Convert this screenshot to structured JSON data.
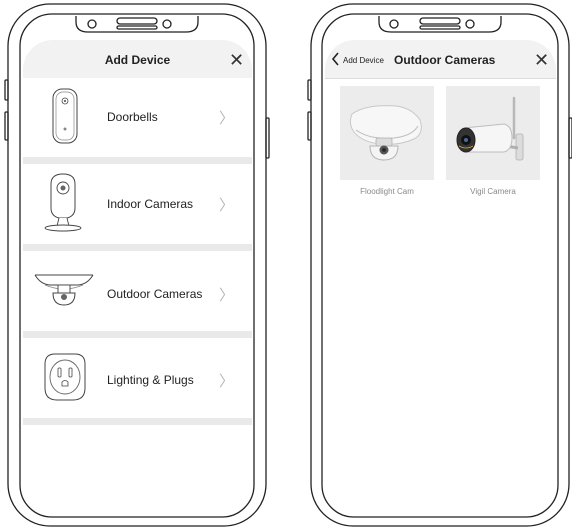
{
  "left_screen": {
    "header_title": "Add Device",
    "close_icon": "close-icon",
    "items": [
      {
        "label": "Doorbells",
        "icon": "doorbell-icon"
      },
      {
        "label": "Indoor Cameras",
        "icon": "indoor-camera-icon"
      },
      {
        "label": "Outdoor Cameras",
        "icon": "outdoor-camera-icon"
      },
      {
        "label": "Lighting & Plugs",
        "icon": "smart-plug-icon"
      }
    ],
    "chevron_icon": "chevron-right-icon"
  },
  "right_screen": {
    "back_label": "Add Device",
    "header_title": "Outdoor Cameras",
    "close_icon": "close-icon",
    "products": [
      {
        "label": "Floodlight Cam",
        "icon": "floodlight-camera-icon"
      },
      {
        "label": "Vigil Camera",
        "icon": "bullet-camera-icon"
      }
    ]
  },
  "colors": {
    "header_bg": "#f2f2f2",
    "separator": "#e9e9e9",
    "caption": "#8a8a8a",
    "chevron": "#b8b8b8"
  }
}
